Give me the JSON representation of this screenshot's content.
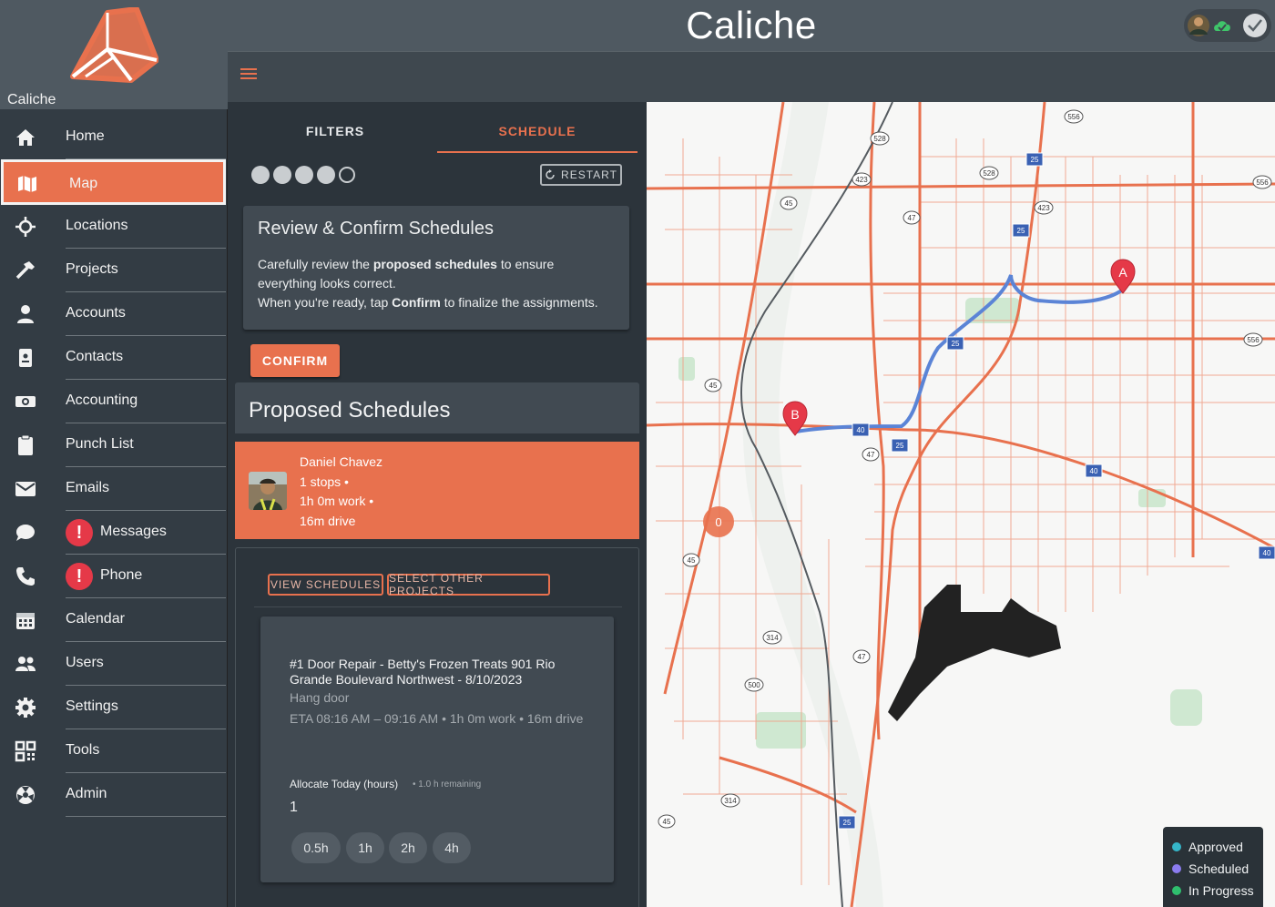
{
  "app": {
    "title": "Caliche",
    "brand_name": "Caliche"
  },
  "sidebar": {
    "items": [
      {
        "label": "Home",
        "icon": "home-icon"
      },
      {
        "label": "Map",
        "icon": "map-icon",
        "active": true
      },
      {
        "label": "Locations",
        "icon": "crosshair-icon"
      },
      {
        "label": "Projects",
        "icon": "hammer-icon"
      },
      {
        "label": "Accounts",
        "icon": "person-icon"
      },
      {
        "label": "Contacts",
        "icon": "phone-book-icon"
      },
      {
        "label": "Accounting",
        "icon": "money-icon"
      },
      {
        "label": "Punch List",
        "icon": "clipboard-icon"
      },
      {
        "label": "Emails",
        "icon": "mail-icon"
      },
      {
        "label": "Messages",
        "icon": "chat-icon",
        "alert": "!"
      },
      {
        "label": "Phone",
        "icon": "phone-icon",
        "alert": "!"
      },
      {
        "label": "Calendar",
        "icon": "calendar-icon"
      },
      {
        "label": "Users",
        "icon": "users-icon"
      },
      {
        "label": "Settings",
        "icon": "gear-icon"
      },
      {
        "label": "Tools",
        "icon": "qr-icon"
      },
      {
        "label": "Admin",
        "icon": "admin-icon"
      }
    ]
  },
  "tabs": {
    "filters": "FILTERS",
    "schedule": "SCHEDULE"
  },
  "stepper": {
    "total": 5,
    "completed": 4
  },
  "restart_label": "RESTART",
  "review": {
    "title": "Review & Confirm Schedules",
    "line1_pre": "Carefully review the ",
    "line1_bold": "proposed schedules",
    "line1_post": " to ensure everything looks correct.",
    "line2_pre": "When you're ready, tap ",
    "line2_bold": "Confirm",
    "line2_post": " to finalize the assignments."
  },
  "confirm_label": "CONFIRM",
  "proposed": {
    "title": "Proposed Schedules",
    "assignee": {
      "name": "Daniel Chavez",
      "stops": "1 stops •",
      "work": "1h 0m work •",
      "drive": "16m drive"
    },
    "view_schedules": "VIEW SCHEDULES",
    "select_other": "SELECT OTHER PROJECTS",
    "job": {
      "title": "#1 Door Repair - Betty's Frozen Treats 901 Rio Grande Boulevard Northwest - 8/10/2023",
      "task": "Hang door",
      "eta": "ETA 08:16 AM – 09:16 AM • 1h 0m work • 16m drive",
      "allocate_label": "Allocate Today (hours)",
      "remaining": "• 1.0 h remaining",
      "allocate_value": "1",
      "chips": [
        "0.5h",
        "1h",
        "2h",
        "4h"
      ]
    }
  },
  "map": {
    "marker_a": "A",
    "marker_b": "B",
    "cluster": "0",
    "shields": [
      "556",
      "528",
      "25",
      "528",
      "423",
      "423",
      "45",
      "47",
      "25",
      "556",
      "25",
      "45",
      "40",
      "47",
      "25",
      "40",
      "45",
      "314",
      "47",
      "500",
      "314",
      "45",
      "25",
      "556",
      "40"
    ],
    "legend": [
      {
        "label": "Approved",
        "color": "#35b6c9"
      },
      {
        "label": "Scheduled",
        "color": "#8b7cf0"
      },
      {
        "label": "In Progress",
        "color": "#2fbf6e"
      }
    ]
  },
  "colors": {
    "accent": "#e8714e",
    "road": "#e8714e",
    "route": "#5b84d6"
  }
}
